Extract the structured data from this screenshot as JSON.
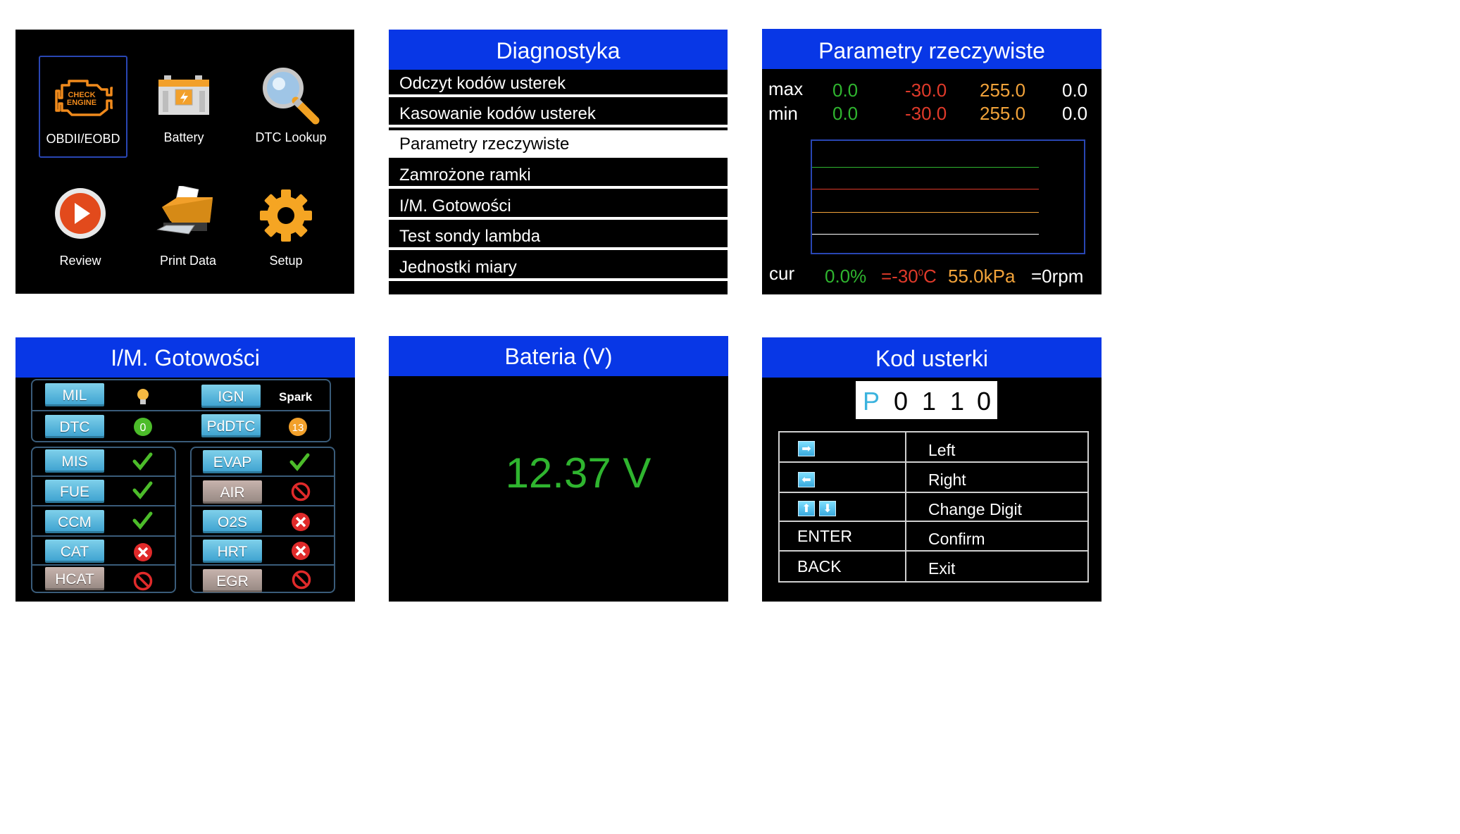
{
  "panel1": {
    "tiles": [
      {
        "label": "OBDII/EOBD",
        "icon": "check-engine-icon"
      },
      {
        "label": "Battery",
        "icon": "battery-icon"
      },
      {
        "label": "DTC Lookup",
        "icon": "magnifier-icon"
      },
      {
        "label": "Review",
        "icon": "play-icon"
      },
      {
        "label": "Print Data",
        "icon": "printer-icon"
      },
      {
        "label": "Setup",
        "icon": "gear-icon"
      }
    ],
    "check_engine_text": [
      "CHECK",
      "ENGINE"
    ]
  },
  "panel2": {
    "title": "Diagnostyka",
    "items": [
      "Odczyt kodów usterek",
      "Kasowanie kodów usterek",
      "Parametry rzeczywiste",
      "Zamrożone ramki",
      "I/M. Gotowości",
      "Test sondy lambda",
      "Jednostki miary"
    ],
    "selected_index": 2
  },
  "panel3": {
    "title": "Parametry rzeczywiste",
    "max_label": "max",
    "min_label": "min",
    "cur_label": "cur",
    "max_values": [
      "0.0",
      "-30.0",
      "255.0",
      "0.0"
    ],
    "min_values": [
      "0.0",
      "-30.0",
      "255.0",
      "0.0"
    ],
    "cur_values": [
      "0.0%",
      "=-30",
      "C",
      "55.0kPa",
      "=0rpm"
    ],
    "cur_degree": "0",
    "colors": {
      "green": "#2fb52f",
      "red": "#e03a2a",
      "orange": "#f2a33a",
      "white": "#ffffff"
    }
  },
  "panel4": {
    "title": "I/M. Gotowości",
    "spark_label": "Spark",
    "dtc_count": "0",
    "pddtc_count": "13",
    "top": [
      {
        "label": "MIL"
      },
      {
        "label": "IGN"
      },
      {
        "label": "DTC"
      },
      {
        "label": "PdDTC"
      }
    ],
    "left": [
      {
        "label": "MIS",
        "status": "ok"
      },
      {
        "label": "FUE",
        "status": "ok"
      },
      {
        "label": "CCM",
        "status": "ok"
      },
      {
        "label": "CAT",
        "status": "fail"
      },
      {
        "label": "HCAT",
        "status": "na"
      }
    ],
    "right": [
      {
        "label": "EVAP",
        "status": "ok"
      },
      {
        "label": "AIR",
        "status": "na"
      },
      {
        "label": "O2S",
        "status": "fail"
      },
      {
        "label": "HRT",
        "status": "fail"
      },
      {
        "label": "EGR",
        "status": "na"
      }
    ]
  },
  "panel5": {
    "title": "Bateria (V)",
    "voltage": "12.37",
    "unit": "V",
    "value_color": "#2fb52f"
  },
  "panel6": {
    "title": "Kod usterki",
    "code_chars": [
      "P",
      "0",
      "1",
      "1",
      "0"
    ],
    "rows": [
      {
        "key_icons": [
          "arrow-right-icon"
        ],
        "key_text": "",
        "action": "Left"
      },
      {
        "key_icons": [
          "arrow-left-icon"
        ],
        "key_text": "",
        "action": "Right"
      },
      {
        "key_icons": [
          "arrow-up-icon",
          "arrow-down-icon"
        ],
        "key_text": "",
        "action": "Change Digit"
      },
      {
        "key_icons": [],
        "key_text": "ENTER",
        "action": "Confirm"
      },
      {
        "key_icons": [],
        "key_text": "BACK",
        "action": "Exit"
      }
    ]
  }
}
